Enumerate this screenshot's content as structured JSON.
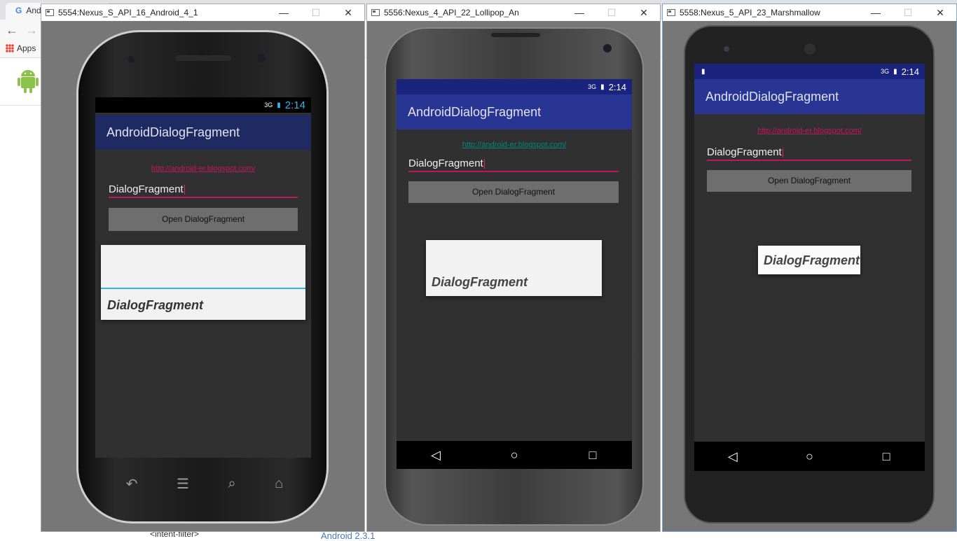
{
  "background": {
    "tab_label": "And",
    "apps_label": "Apps",
    "footer_tag": "<intent-filter>",
    "footer_link": "Android 2.3.1"
  },
  "emulators": [
    {
      "window_title": "5554:Nexus_S_API_16_Android_4_1",
      "time": "2:14",
      "signal": "3G",
      "app_title": "AndroidDialogFragment",
      "link": "http://android-er.blogspot.com/",
      "link_color": "#c2185b",
      "edit_value": "DialogFragment",
      "button_label": "Open DialogFragment",
      "dialog_text": "DialogFragment"
    },
    {
      "window_title": "5556:Nexus_4_API_22_Lollipop_An",
      "time": "2:14",
      "signal": "3G",
      "app_title": "AndroidDialogFragment",
      "link": "http://android-er.blogspot.com/",
      "link_color": "#00897b",
      "edit_value": "DialogFragment",
      "button_label": "Open DialogFragment",
      "dialog_text": "DialogFragment"
    },
    {
      "window_title": "5558:Nexus_5_API_23_Marshmallow",
      "time": "2:14",
      "signal": "3G",
      "app_title": "AndroidDialogFragment",
      "link": "http://android-er.blogspot.com/",
      "link_color": "#c2185b",
      "edit_value": "DialogFragment",
      "button_label": "Open DialogFragment",
      "dialog_text": "DialogFragment"
    }
  ],
  "window_controls": {
    "minimize": "—",
    "maximize": "☐",
    "close": "✕"
  },
  "nav_icons": {
    "back": "◁",
    "home": "○",
    "recents": "□"
  },
  "hw_key_icons": {
    "back": "↶",
    "menu": "☰",
    "search": "⌕",
    "home": "⌂"
  },
  "colors": {
    "actionbar": "#1f2a63",
    "screen_bg": "#303030",
    "accent": "#c2185b"
  }
}
